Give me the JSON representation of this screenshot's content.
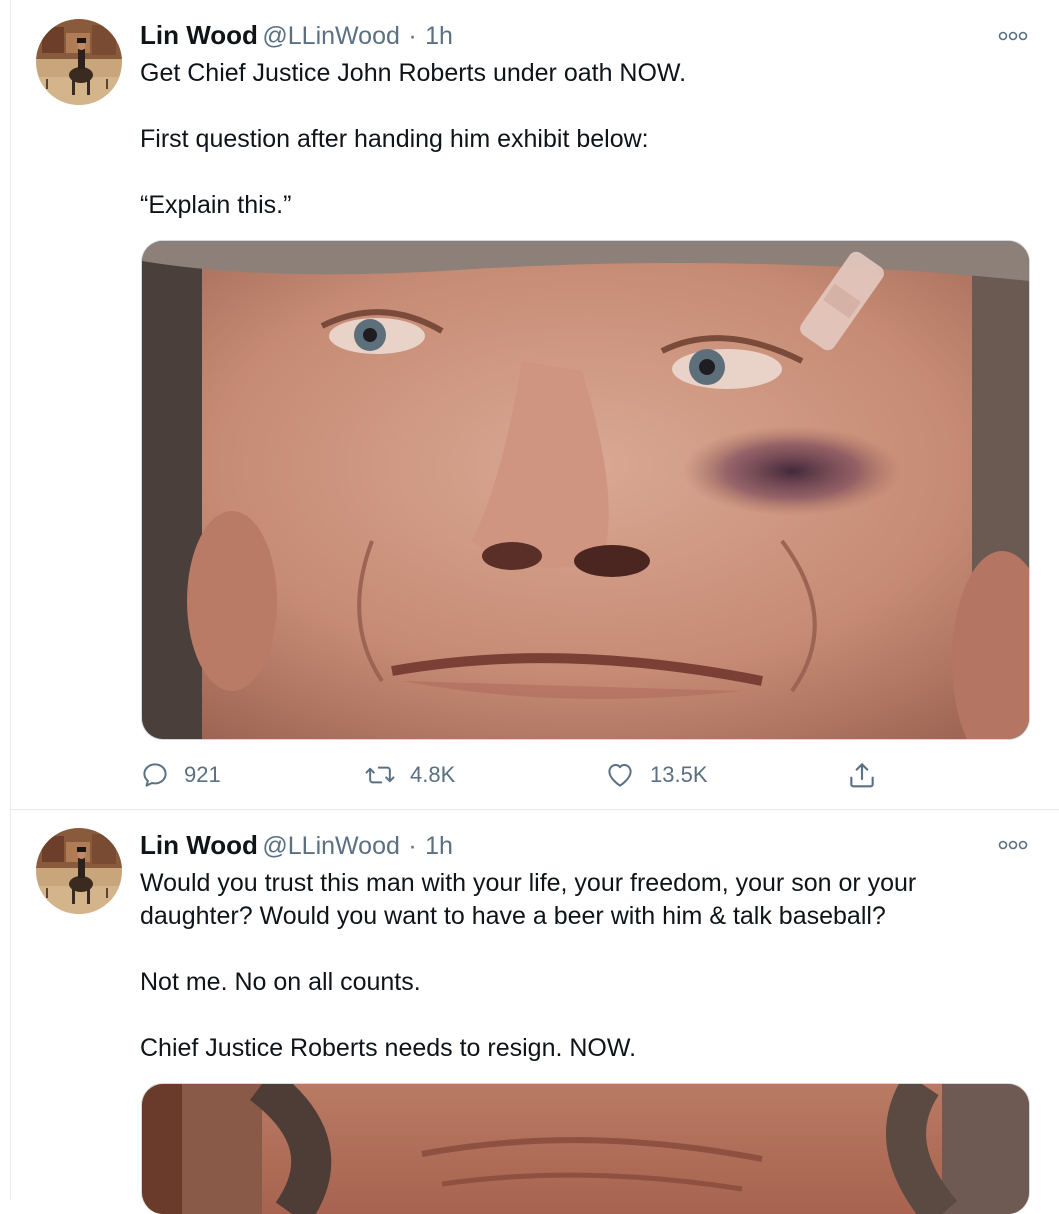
{
  "tweets": [
    {
      "author": {
        "name": "Lin Wood",
        "handle": "@LLinWood"
      },
      "separator": "·",
      "time": "1h",
      "more_icon": "more-horizontal-icon",
      "text": [
        "Get Chief Justice John Roberts under oath NOW.",
        "First question after handing him exhibit below:",
        "“Explain this.”"
      ],
      "media": {
        "kind": "photo"
      },
      "actions": {
        "reply": {
          "icon": "reply-bubble-icon",
          "count": "921"
        },
        "retweet": {
          "icon": "retweet-icon",
          "count": "4.8K"
        },
        "like": {
          "icon": "heart-icon",
          "count": "13.5K"
        },
        "share": {
          "icon": "share-upload-icon"
        }
      }
    },
    {
      "author": {
        "name": "Lin Wood",
        "handle": "@LLinWood"
      },
      "separator": "·",
      "time": "1h",
      "more_icon": "more-horizontal-icon",
      "text": [
        "Would you trust this man with your life, your freedom, your son or your daughter? Would you want to have a beer with him & talk baseball?",
        "Not me. No on all counts.",
        "Chief Justice Roberts needs to resign. NOW."
      ],
      "media": {
        "kind": "photo"
      }
    }
  ],
  "colors": {
    "text_primary": "#0f1419",
    "text_secondary": "#5b7083",
    "border": "#e6ecf0"
  }
}
